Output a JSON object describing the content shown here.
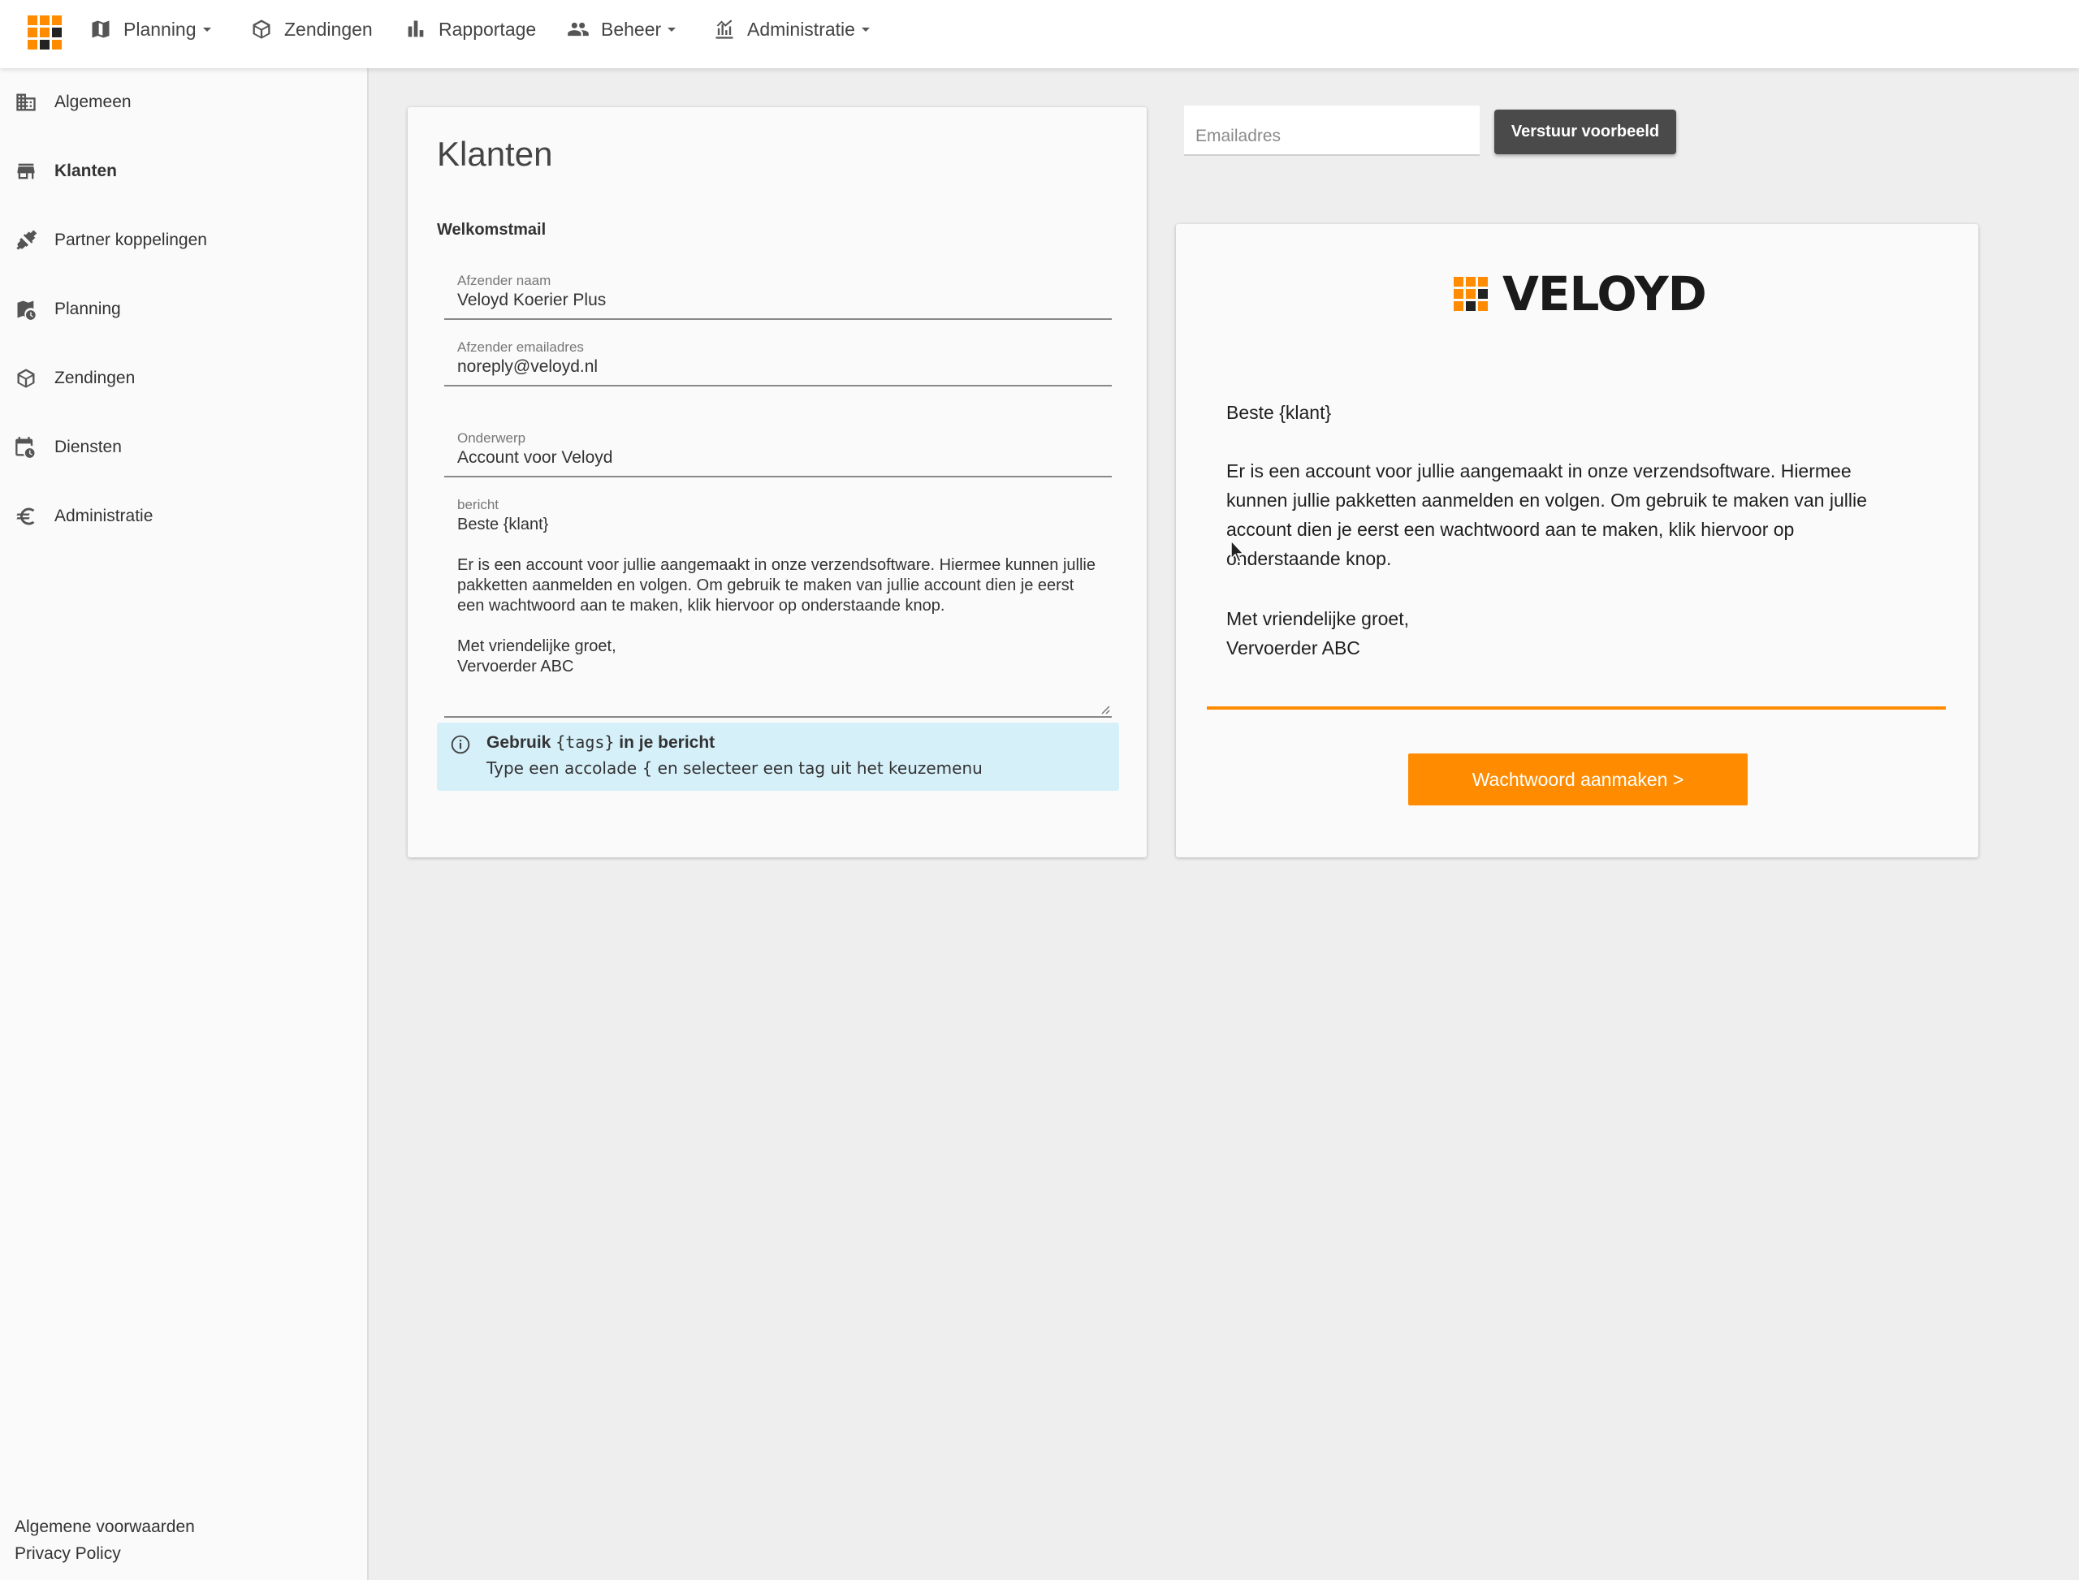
{
  "colors": {
    "accent": "#ff8c00",
    "logo_dark": "#222222",
    "info_bg": "#d6f0fa"
  },
  "topnav": {
    "items": [
      {
        "label": "Planning",
        "icon": "map-icon",
        "has_dropdown": true
      },
      {
        "label": "Zendingen",
        "icon": "box-icon",
        "has_dropdown": false
      },
      {
        "label": "Rapportage",
        "icon": "bar-chart-icon",
        "has_dropdown": false
      },
      {
        "label": "Beheer",
        "icon": "people-icon",
        "has_dropdown": true
      },
      {
        "label": "Administratie",
        "icon": "finance-chart-icon",
        "has_dropdown": true
      }
    ]
  },
  "sidebar": {
    "items": [
      {
        "label": "Algemeen",
        "icon": "building-icon"
      },
      {
        "label": "Klanten",
        "icon": "store-icon",
        "active": true
      },
      {
        "label": "Partner koppelingen",
        "icon": "plug-icon"
      },
      {
        "label": "Planning",
        "icon": "map-clock-icon"
      },
      {
        "label": "Zendingen",
        "icon": "box-icon"
      },
      {
        "label": "Diensten",
        "icon": "calendar-clock-icon"
      },
      {
        "label": "Administratie",
        "icon": "euro-icon"
      }
    ],
    "footer": {
      "terms": "Algemene voorwaarden",
      "privacy": "Privacy Policy"
    }
  },
  "form": {
    "title": "Klanten",
    "section": "Welkomstmail",
    "sender_name": {
      "label": "Afzender naam",
      "value": "Veloyd Koerier Plus"
    },
    "sender_email": {
      "label": "Afzender emailadres",
      "value": "noreply@veloyd.nl"
    },
    "subject": {
      "label": "Onderwerp",
      "value": "Account voor Veloyd"
    },
    "message": {
      "label": "bericht",
      "value": "Beste {klant}\n\nEr is een account voor jullie aangemaakt in onze verzendsoftware. Hiermee kunnen jullie pakketten aanmelden en volgen. Om gebruik te maken van jullie account dien je eerst een wachtwoord aan te maken, klik hiervoor op onderstaande knop.\n\nMet vriendelijke groet,\nVervoerder ABC"
    },
    "info": {
      "prefix": "Gebruik",
      "tag": "{tags}",
      "suffix": "in je bericht",
      "hint": "Type een accolade { en selecteer een tag uit het keuzemenu"
    }
  },
  "preview_controls": {
    "email_placeholder": "Emailadres",
    "send_label": "Verstuur voorbeeld"
  },
  "preview": {
    "brand": "VELOYD",
    "greeting": "Beste {klant}",
    "body_lines": [
      "Er is een account voor jullie aangemaakt in onze verzendsoftware. Hiermee",
      "kunnen jullie pakketten aanmelden en volgen. Om gebruik te maken van jullie",
      "account dien je eerst een wachtwoord aan te maken, klik hiervoor op",
      "onderstaande knop."
    ],
    "closing_1": "Met vriendelijke groet,",
    "closing_2": "Vervoerder ABC",
    "cta": "Wachtwoord aanmaken >"
  }
}
